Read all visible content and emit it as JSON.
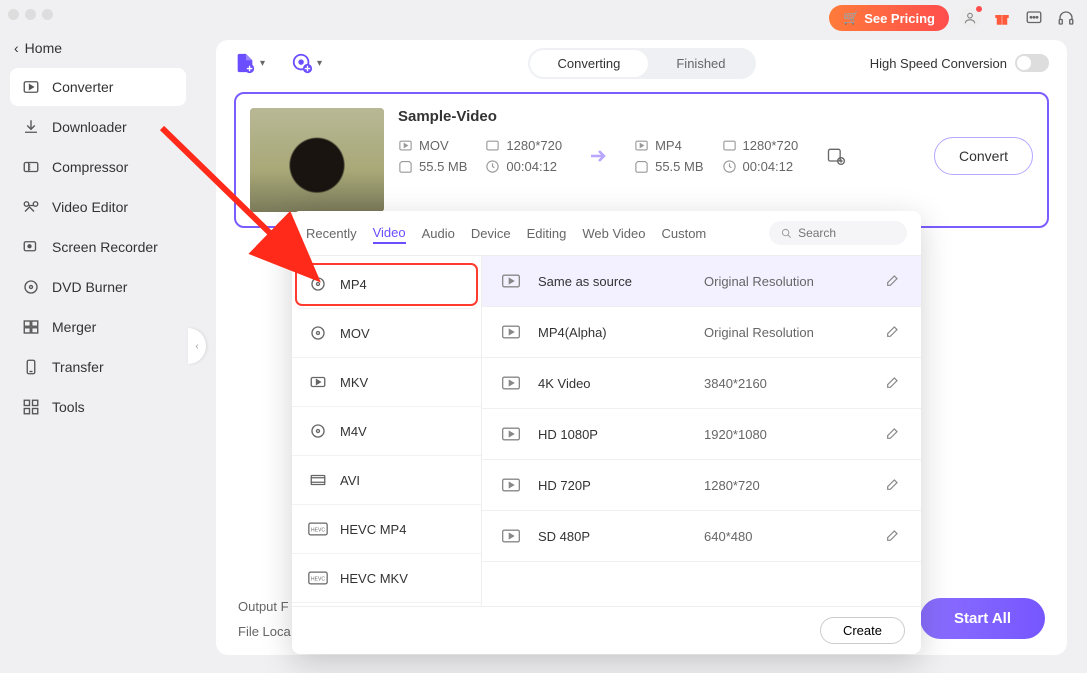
{
  "home_label": "Home",
  "pricing_label": "See Pricing",
  "nav": [
    {
      "label": "Converter",
      "icon": "converter",
      "active": true
    },
    {
      "label": "Downloader",
      "icon": "download",
      "active": false
    },
    {
      "label": "Compressor",
      "icon": "compress",
      "active": false
    },
    {
      "label": "Video Editor",
      "icon": "editor",
      "active": false
    },
    {
      "label": "Screen Recorder",
      "icon": "recorder",
      "active": false
    },
    {
      "label": "DVD Burner",
      "icon": "dvd",
      "active": false
    },
    {
      "label": "Merger",
      "icon": "merger",
      "active": false
    },
    {
      "label": "Transfer",
      "icon": "transfer",
      "active": false
    },
    {
      "label": "Tools",
      "icon": "tools",
      "active": false
    }
  ],
  "tabs": {
    "converting": "Converting",
    "finished": "Finished"
  },
  "speed_label": "High Speed Conversion",
  "video": {
    "title": "Sample-Video",
    "src": {
      "format": "MOV",
      "res": "1280*720",
      "size": "55.5 MB",
      "dur": "00:04:12"
    },
    "dst": {
      "format": "MP4",
      "res": "1280*720",
      "size": "55.5 MB",
      "dur": "00:04:12"
    },
    "convert_label": "Convert"
  },
  "footer": {
    "output": "Output F",
    "location": "File Loca",
    "start_all": "Start All"
  },
  "popup": {
    "tabs": [
      "Recently",
      "Video",
      "Audio",
      "Device",
      "Editing",
      "Web Video",
      "Custom"
    ],
    "active_tab": 1,
    "search_placeholder": "Search",
    "formats": [
      "MP4",
      "MOV",
      "MKV",
      "M4V",
      "AVI",
      "HEVC MP4",
      "HEVC MKV"
    ],
    "selected_format": 0,
    "presets": [
      {
        "name": "Same as source",
        "res": "Original Resolution",
        "active": true
      },
      {
        "name": "MP4(Alpha)",
        "res": "Original Resolution"
      },
      {
        "name": "4K Video",
        "res": "3840*2160"
      },
      {
        "name": "HD 1080P",
        "res": "1920*1080"
      },
      {
        "name": "HD 720P",
        "res": "1280*720"
      },
      {
        "name": "SD 480P",
        "res": "640*480"
      }
    ],
    "create_label": "Create"
  }
}
